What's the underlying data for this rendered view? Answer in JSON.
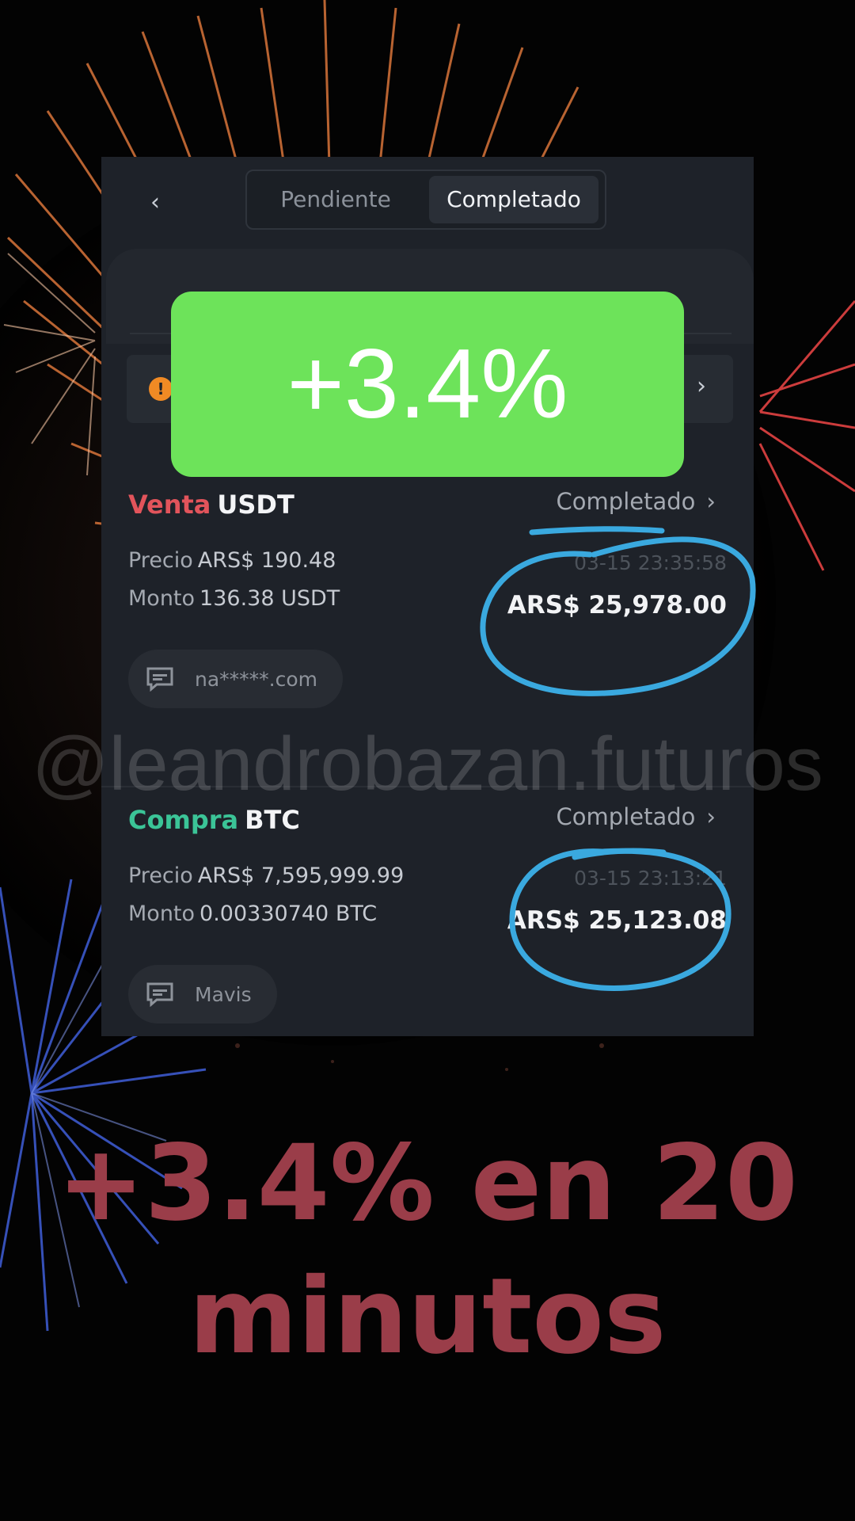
{
  "header": {
    "tabs": [
      "Pendiente",
      "Completado"
    ],
    "active_tab": "Completado"
  },
  "badge": {
    "text": "+3.4%"
  },
  "orders": [
    {
      "side": "Venta",
      "asset": "USDT",
      "status": "Completado",
      "price_label": "Precio",
      "price": "ARS$ 190.48",
      "amount_label": "Monto",
      "amount": "136.38 USDT",
      "datetime": "03-15 23:35:58",
      "total": "ARS$ 25,978.00",
      "contact": "na*****.com"
    },
    {
      "side": "Compra",
      "asset": "BTC",
      "status": "Completado",
      "price_label": "Precio",
      "price": "ARS$ 7,595,999.99",
      "amount_label": "Monto",
      "amount": "0.00330740 BTC",
      "datetime": "03-15 23:13:21",
      "total": "ARS$ 25,123.08",
      "contact": "Mavis"
    }
  ],
  "watermark": "@leandrobazan.futuros",
  "caption": {
    "line1": "+3.4% en 20",
    "line2": "minutos"
  },
  "colors": {
    "sell": "#e2545b",
    "buy": "#3bc497",
    "badge": "#6de35a",
    "caption": "#9a3d49",
    "highlight": "#3aa9df"
  }
}
